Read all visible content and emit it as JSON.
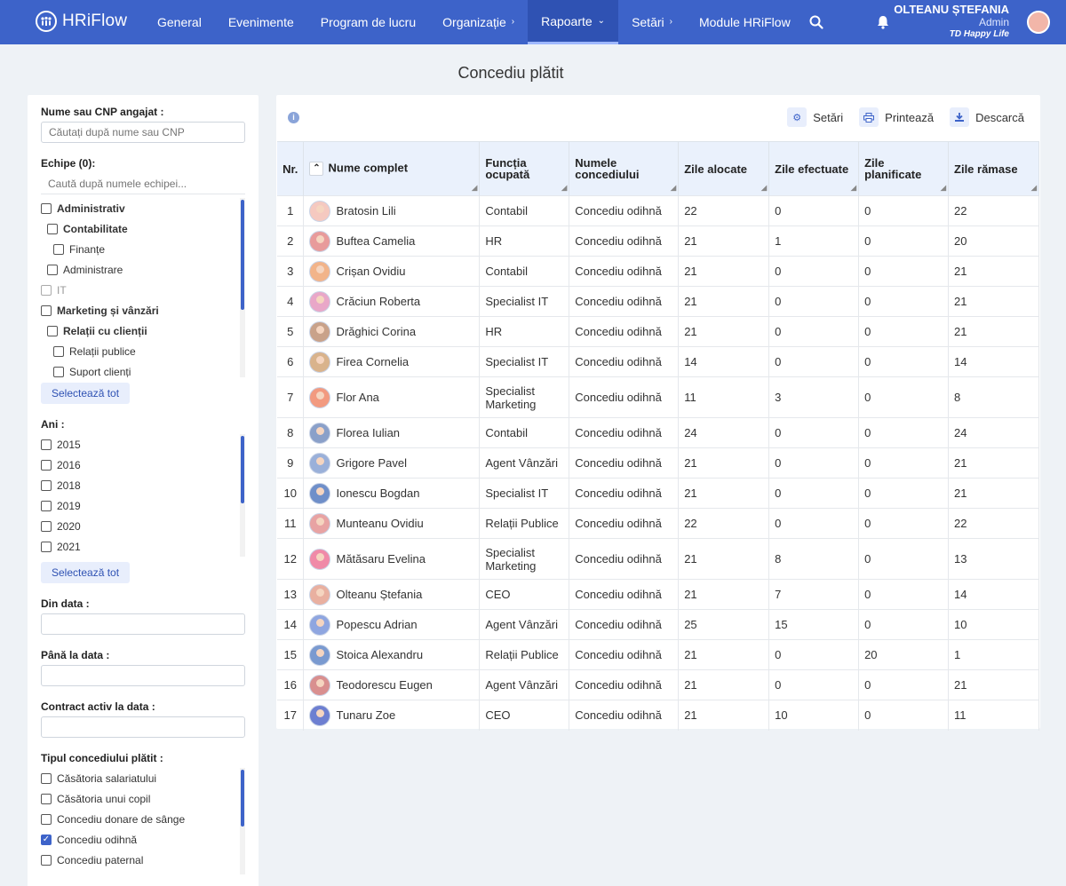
{
  "app": {
    "logo_text": "HRiFlow"
  },
  "nav": {
    "items": [
      {
        "label": "General",
        "chevron": ""
      },
      {
        "label": "Evenimente",
        "chevron": ""
      },
      {
        "label": "Program de lucru",
        "chevron": ""
      },
      {
        "label": "Organizație",
        "chevron": "›"
      },
      {
        "label": "Rapoarte",
        "chevron": "⌄"
      },
      {
        "label": "Setări",
        "chevron": "›"
      },
      {
        "label": "Module HRiFlow",
        "chevron": ""
      }
    ],
    "active_index": 4
  },
  "user": {
    "name": "OLTEANU ȘTEFANIA",
    "role": "Admin",
    "company": "TD Happy Life"
  },
  "page": {
    "title": "Concediu plătit"
  },
  "filters": {
    "name_label": "Nume sau CNP angajat :",
    "name_placeholder": "Căutați după nume sau CNP",
    "teams_label": "Echipe (0):",
    "teams_placeholder": "Caută după numele echipei...",
    "teams": [
      {
        "label": "Administrativ",
        "indent": 0,
        "bold": true,
        "disabled": false
      },
      {
        "label": "Contabilitate",
        "indent": 1,
        "bold": true,
        "disabled": false
      },
      {
        "label": "Finanțe",
        "indent": 2,
        "bold": false,
        "disabled": false
      },
      {
        "label": "Administrare",
        "indent": 1,
        "bold": false,
        "disabled": false
      },
      {
        "label": "IT",
        "indent": 0,
        "bold": false,
        "disabled": true
      },
      {
        "label": "Marketing și vânzări",
        "indent": 0,
        "bold": true,
        "disabled": false
      },
      {
        "label": "Relații cu clienții",
        "indent": 1,
        "bold": true,
        "disabled": false
      },
      {
        "label": "Relații publice",
        "indent": 2,
        "bold": false,
        "disabled": false
      },
      {
        "label": "Suport clienți",
        "indent": 2,
        "bold": false,
        "disabled": false
      }
    ],
    "select_all_label": "Selectează tot",
    "years_label": "Ani :",
    "years": [
      "2015",
      "2016",
      "2018",
      "2019",
      "2020",
      "2021"
    ],
    "from_label": "Din data :",
    "to_label": "Până la data :",
    "contract_label": "Contract activ la data :",
    "leave_type_label": "Tipul concediului plătit :",
    "leave_types": [
      {
        "label": "Căsătoria salariatului",
        "checked": false
      },
      {
        "label": "Căsătoria unui copil",
        "checked": false
      },
      {
        "label": "Concediu donare de sânge",
        "checked": false
      },
      {
        "label": "Concediu odihnă",
        "checked": true
      },
      {
        "label": "Concediu paternal",
        "checked": false
      }
    ]
  },
  "toolbar": {
    "settings_label": "Setări",
    "print_label": "Printează",
    "download_label": "Descarcă"
  },
  "table": {
    "headers": {
      "nr": "Nr.",
      "name": "Nume complet",
      "function": "Funcția ocupată",
      "leave_name": "Numele concediului",
      "allocated": "Zile alocate",
      "taken": "Zile efectuate",
      "planned": "Zile planificate",
      "remaining": "Zile rămase"
    },
    "rows": [
      {
        "nr": "1",
        "name": "Bratosin Lili",
        "function": "Contabil",
        "leave": "Concediu odihnă",
        "allocated": "22",
        "taken": "0",
        "planned": "0",
        "remaining": "22"
      },
      {
        "nr": "2",
        "name": "Buftea Camelia",
        "function": "HR",
        "leave": "Concediu odihnă",
        "allocated": "21",
        "taken": "1",
        "planned": "0",
        "remaining": "20"
      },
      {
        "nr": "3",
        "name": "Crișan Ovidiu",
        "function": "Contabil",
        "leave": "Concediu odihnă",
        "allocated": "21",
        "taken": "0",
        "planned": "0",
        "remaining": "21"
      },
      {
        "nr": "4",
        "name": "Crăciun Roberta",
        "function": "Specialist IT",
        "leave": "Concediu odihnă",
        "allocated": "21",
        "taken": "0",
        "planned": "0",
        "remaining": "21"
      },
      {
        "nr": "5",
        "name": "Drăghici Corina",
        "function": "HR",
        "leave": "Concediu odihnă",
        "allocated": "21",
        "taken": "0",
        "planned": "0",
        "remaining": "21"
      },
      {
        "nr": "6",
        "name": "Firea Cornelia",
        "function": "Specialist IT",
        "leave": "Concediu odihnă",
        "allocated": "14",
        "taken": "0",
        "planned": "0",
        "remaining": "14"
      },
      {
        "nr": "7",
        "name": "Flor Ana",
        "function": "Specialist Marketing",
        "leave": "Concediu odihnă",
        "allocated": "11",
        "taken": "3",
        "planned": "0",
        "remaining": "8"
      },
      {
        "nr": "8",
        "name": "Florea Iulian",
        "function": "Contabil",
        "leave": "Concediu odihnă",
        "allocated": "24",
        "taken": "0",
        "planned": "0",
        "remaining": "24"
      },
      {
        "nr": "9",
        "name": "Grigore Pavel",
        "function": "Agent Vânzări",
        "leave": "Concediu odihnă",
        "allocated": "21",
        "taken": "0",
        "planned": "0",
        "remaining": "21"
      },
      {
        "nr": "10",
        "name": "Ionescu Bogdan",
        "function": "Specialist IT",
        "leave": "Concediu odihnă",
        "allocated": "21",
        "taken": "0",
        "planned": "0",
        "remaining": "21"
      },
      {
        "nr": "11",
        "name": "Munteanu Ovidiu",
        "function": "Relații Publice",
        "leave": "Concediu odihnă",
        "allocated": "22",
        "taken": "0",
        "planned": "0",
        "remaining": "22"
      },
      {
        "nr": "12",
        "name": "Mătăsaru Evelina",
        "function": "Specialist Marketing",
        "leave": "Concediu odihnă",
        "allocated": "21",
        "taken": "8",
        "planned": "0",
        "remaining": "13"
      },
      {
        "nr": "13",
        "name": "Olteanu Ștefania",
        "function": "CEO",
        "leave": "Concediu odihnă",
        "allocated": "21",
        "taken": "7",
        "planned": "0",
        "remaining": "14"
      },
      {
        "nr": "14",
        "name": "Popescu Adrian",
        "function": "Agent Vânzări",
        "leave": "Concediu odihnă",
        "allocated": "25",
        "taken": "15",
        "planned": "0",
        "remaining": "10"
      },
      {
        "nr": "15",
        "name": "Stoica Alexandru",
        "function": "Relații Publice",
        "leave": "Concediu odihnă",
        "allocated": "21",
        "taken": "0",
        "planned": "20",
        "remaining": "1"
      },
      {
        "nr": "16",
        "name": "Teodorescu Eugen",
        "function": "Agent Vânzări",
        "leave": "Concediu odihnă",
        "allocated": "21",
        "taken": "0",
        "planned": "0",
        "remaining": "21"
      },
      {
        "nr": "17",
        "name": "Tunaru Zoe",
        "function": "CEO",
        "leave": "Concediu odihnă",
        "allocated": "21",
        "taken": "10",
        "planned": "0",
        "remaining": "11"
      }
    ]
  },
  "colors": {
    "brand": "#3d63c9",
    "header_bg": "#eaf1fc",
    "page_bg": "#eef2f6"
  }
}
